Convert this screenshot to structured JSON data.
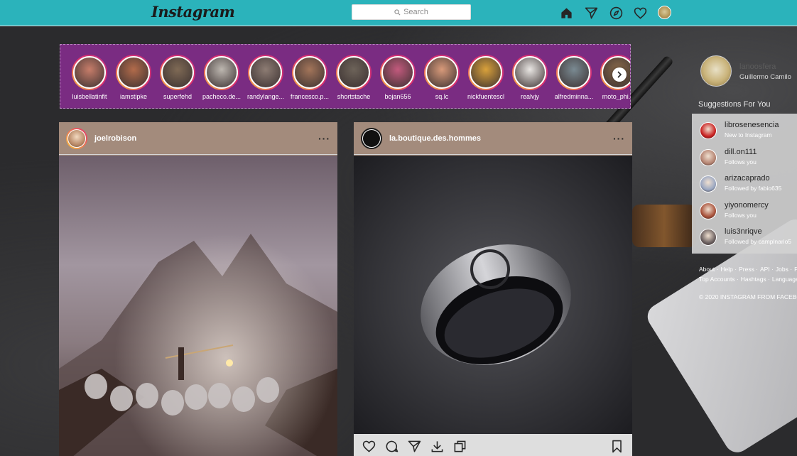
{
  "topbar": {
    "logo": "Instagram",
    "search_placeholder": "Search"
  },
  "nav_icons": [
    "home-icon",
    "direct-icon",
    "explore-icon",
    "activity-heart-icon",
    "profile-avatar"
  ],
  "stories": [
    {
      "name": "luisbellatinfit",
      "color": "#c77d6a"
    },
    {
      "name": "iamstipke",
      "color": "#b26b4b"
    },
    {
      "name": "superfehd",
      "color": "#7f6a55"
    },
    {
      "name": "pacheco.de...",
      "color": "#bdb7b0"
    },
    {
      "name": "randylange...",
      "color": "#8d7c73"
    },
    {
      "name": "francesco.p...",
      "color": "#a3755a"
    },
    {
      "name": "shortstache",
      "color": "#6d6359"
    },
    {
      "name": "bojan656",
      "color": "#c25a7d"
    },
    {
      "name": "sq.lc",
      "color": "#d89a7a"
    },
    {
      "name": "nickfuentescl",
      "color": "#d9a13b"
    },
    {
      "name": "realvjy",
      "color": "#e9e6e3"
    },
    {
      "name": "alfredminna...",
      "color": "#7a8a92"
    },
    {
      "name": "moto_phi...",
      "color": "#8a6a4a"
    }
  ],
  "posts": [
    {
      "username": "joelrobison",
      "more": "···"
    },
    {
      "username": "la.boutique.des.hommes",
      "more": "···"
    }
  ],
  "profile": {
    "handle": "lanoosfera",
    "name": "Guillermo Camilo"
  },
  "suggestions": {
    "title": "Suggestions For You",
    "items": [
      {
        "name": "librosenesencia",
        "sub": "New to Instagram",
        "color": "#c92020"
      },
      {
        "name": "dill.on111",
        "sub": "Follows you",
        "color": "#b58472"
      },
      {
        "name": "arizacaprado",
        "sub": "Followed by fabio635",
        "color": "#9aa7c2"
      },
      {
        "name": "yiyonomercy",
        "sub": "Follows you",
        "color": "#a8513a"
      },
      {
        "name": "luis3nriqve",
        "sub": "Followed by camplnario5",
        "color": "#6b6060"
      }
    ]
  },
  "footer": {
    "links_row1": [
      "About ·",
      "Help ·",
      "Press ·",
      "API ·",
      "Jobs ·",
      "Privacy"
    ],
    "links_row2": [
      "Top Accounts ·",
      "Hashtags ·",
      "Language"
    ],
    "copyright": "© 2020 INSTAGRAM FROM FACEBOOK"
  },
  "colors": {
    "topbar": "#2bb3bb",
    "stories_bg": "#7a2c82",
    "post_header": "#a38b7c"
  }
}
